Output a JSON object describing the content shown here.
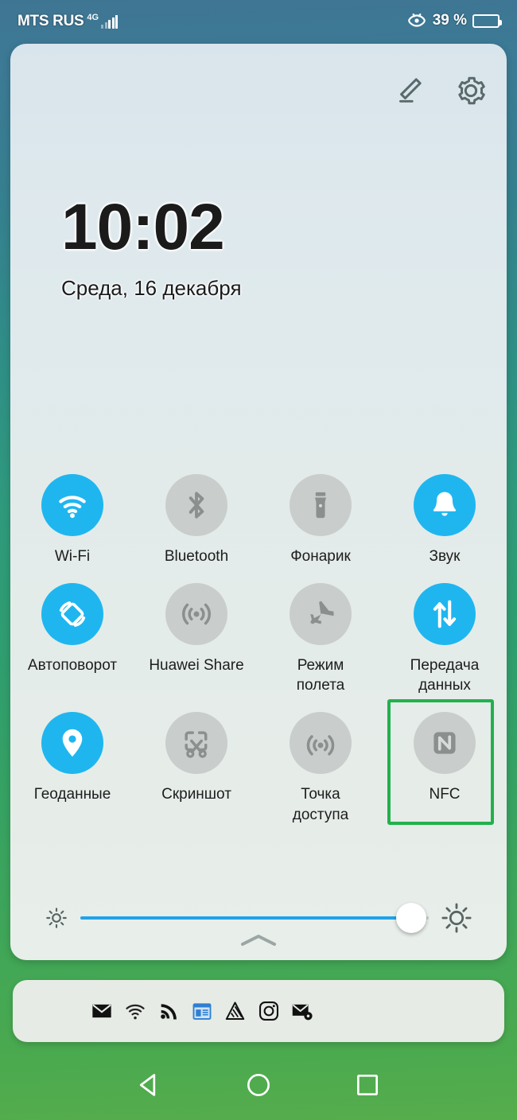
{
  "status_bar": {
    "carrier": "MTS RUS",
    "network_generation": "4G",
    "signal_icon": "signal-bars-icon",
    "eye_comfort_icon": "eye-comfort-icon",
    "battery_percent_text": "39 %",
    "battery_level": 39,
    "battery_icon": "battery-icon"
  },
  "panel": {
    "edit_icon": "pencil-edit-icon",
    "settings_icon": "gear-settings-icon",
    "clock": "10:02",
    "date": "Среда, 16 декабря",
    "collapse_handle_icon": "chevron-up-icon"
  },
  "toggles": {
    "rows": [
      [
        {
          "label": "Wi-Fi",
          "icon": "wifi-icon",
          "state": "on"
        },
        {
          "label": "Bluetooth",
          "icon": "bluetooth-icon",
          "state": "off"
        },
        {
          "label": "Фонарик",
          "icon": "flashlight-icon",
          "state": "off"
        },
        {
          "label": "Звук",
          "icon": "bell-sound-icon",
          "state": "on"
        }
      ],
      [
        {
          "label": "Автоповорот",
          "icon": "auto-rotate-icon",
          "state": "on"
        },
        {
          "label": "Huawei Share",
          "icon": "huawei-share-icon",
          "state": "off"
        },
        {
          "label": "Режим\nполета",
          "icon": "airplane-icon",
          "state": "off"
        },
        {
          "label": "Передача\nданных",
          "icon": "data-transfer-icon",
          "state": "on"
        }
      ],
      [
        {
          "label": "Геоданные",
          "icon": "location-pin-icon",
          "state": "on"
        },
        {
          "label": "Скриншот",
          "icon": "screenshot-icon",
          "state": "off"
        },
        {
          "label": "Точка\nдоступа",
          "icon": "hotspot-icon",
          "state": "off"
        },
        {
          "label": "NFC",
          "icon": "nfc-icon",
          "state": "off",
          "highlighted": true
        }
      ]
    ]
  },
  "brightness": {
    "low_icon": "sun-small-icon",
    "high_icon": "sun-large-icon",
    "value_percent": 95
  },
  "notifications": {
    "icons": [
      "email-icon",
      "wifi-question-icon",
      "rss-feed-icon",
      "calendar-news-icon",
      "mountain-logo-icon",
      "instagram-icon",
      "email-settings-icon"
    ]
  },
  "navigation_bar": {
    "back_icon": "back-triangle-icon",
    "home_icon": "home-circle-icon",
    "recents_icon": "recents-square-icon"
  },
  "colors": {
    "toggle_on": "#1fb6f0",
    "toggle_off": "#c9cdcb",
    "highlight_box": "#22b14c",
    "slider_fill": "#1fa3e8",
    "panel_bg": "#e2ebea"
  }
}
